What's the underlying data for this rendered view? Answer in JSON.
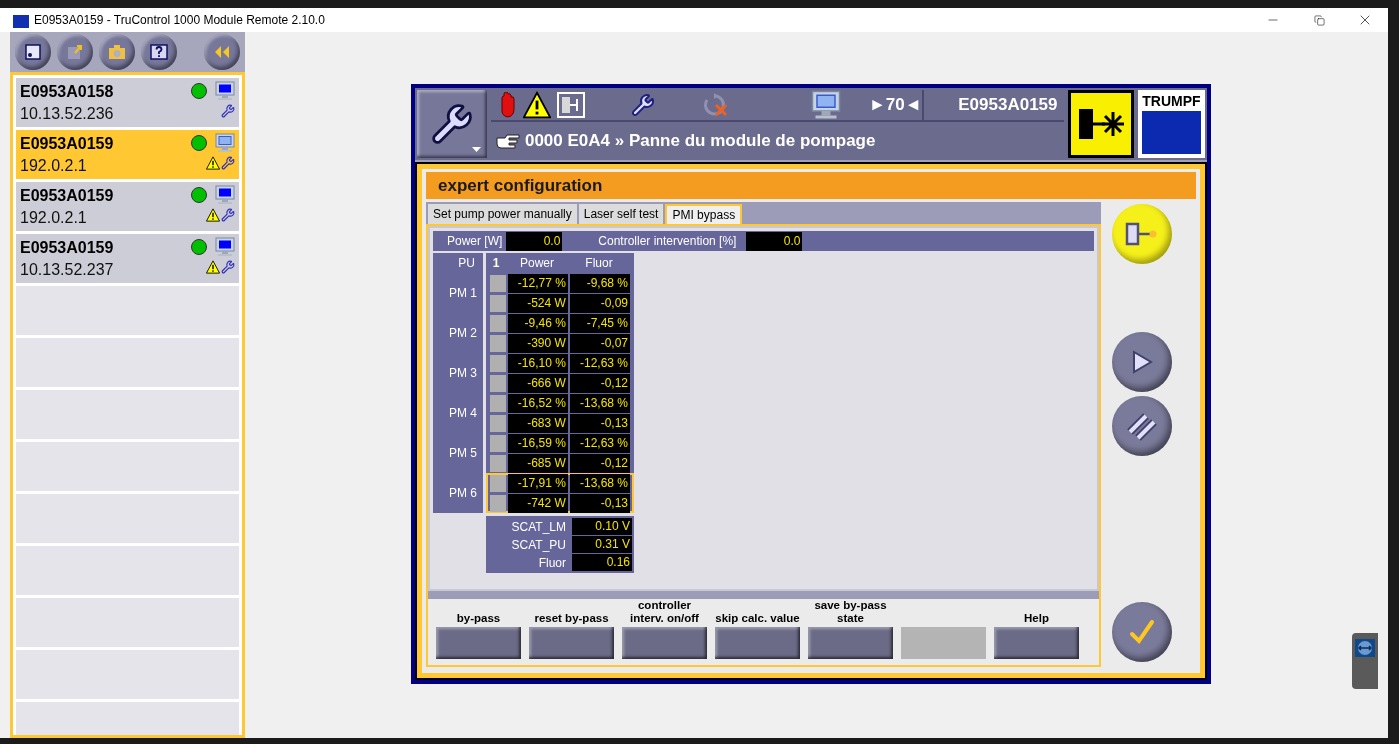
{
  "window": {
    "title": "E0953A0159 - TruControl 1000 Module Remote 2.10.0"
  },
  "machines": [
    {
      "name": "E0953A0158",
      "ip": "10.13.52.236",
      "selected": false,
      "warning": false,
      "color": "#00c000"
    },
    {
      "name": "E0953A0159",
      "ip": "192.0.2.1",
      "selected": true,
      "warning": true,
      "color": "#00c000"
    },
    {
      "name": "E0953A0159",
      "ip": "192.0.2.1",
      "selected": false,
      "warning": true,
      "color": "#00c000"
    },
    {
      "name": "E0953A0159",
      "ip": "10.13.52.237",
      "selected": false,
      "warning": true,
      "color": "#00c000"
    }
  ],
  "header": {
    "counter": "►70◄",
    "machine_id": "E0953A0159",
    "message": "0000 E0A4 » Panne du module de pompage",
    "logo": "TRUMPF"
  },
  "panel": {
    "title": "expert configuration",
    "tabs": [
      {
        "label": "Set pump power manually",
        "selected": false
      },
      {
        "label": "Laser self test",
        "selected": false
      },
      {
        "label": "PMI bypass",
        "selected": true
      }
    ],
    "power": {
      "label": "Power [W]",
      "value": "0.0"
    },
    "intervention": {
      "label": "Controller intervention [%]",
      "value": "0.0"
    },
    "table": {
      "columns": [
        "PU",
        "1",
        "Power",
        "Fluor"
      ],
      "modules": [
        {
          "name": "PM 1",
          "selected": false,
          "power_pct": "-12,77 %",
          "fluor_pct": "-9,68 %",
          "power_w": "-524 W",
          "fluor": "-0,09"
        },
        {
          "name": "PM 2",
          "selected": false,
          "power_pct": "-9,46 %",
          "fluor_pct": "-7,45 %",
          "power_w": "-390 W",
          "fluor": "-0,07"
        },
        {
          "name": "PM 3",
          "selected": false,
          "power_pct": "-16,10 %",
          "fluor_pct": "-12,63 %",
          "power_w": "-666 W",
          "fluor": "-0,12"
        },
        {
          "name": "PM 4",
          "selected": false,
          "power_pct": "-16,52 %",
          "fluor_pct": "-13,68 %",
          "power_w": "-683 W",
          "fluor": "-0,13"
        },
        {
          "name": "PM 5",
          "selected": false,
          "power_pct": "-16,59 %",
          "fluor_pct": "-12,63 %",
          "power_w": "-685 W",
          "fluor": "-0,12"
        },
        {
          "name": "PM 6",
          "selected": true,
          "power_pct": "-17,91 %",
          "fluor_pct": "-13,68 %",
          "power_w": "-742 W",
          "fluor": "-0,13"
        }
      ]
    },
    "scat": [
      {
        "label": "SCAT_LM",
        "value": "0.10 V"
      },
      {
        "label": "SCAT_PU",
        "value": "0.31 V"
      },
      {
        "label": "Fluor",
        "value": "0.16"
      }
    ],
    "buttons": [
      {
        "label": "by-pass",
        "disabled": false
      },
      {
        "label": "reset by-pass",
        "disabled": false
      },
      {
        "label": "controller interv. on/off",
        "disabled": false
      },
      {
        "label": "skip calc. value",
        "disabled": false
      },
      {
        "label": "save by-pass state",
        "disabled": false
      },
      {
        "disabled": true
      },
      {
        "label": "Help",
        "disabled": false
      }
    ]
  }
}
